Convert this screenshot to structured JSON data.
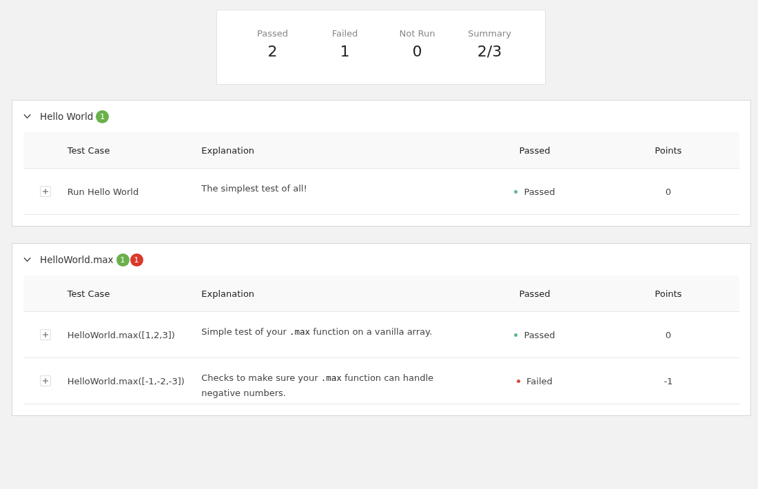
{
  "summary": [
    {
      "label": "Passed",
      "value": "2"
    },
    {
      "label": "Failed",
      "value": "1"
    },
    {
      "label": "Not Run",
      "value": "0"
    },
    {
      "label": "Summary",
      "value": "2/3"
    }
  ],
  "suites": [
    {
      "name": "Hello World",
      "expanded": true,
      "badges": [
        {
          "count": "1",
          "color": "#6ab04c"
        }
      ],
      "columns": [
        "Test Case",
        "Explanation",
        "Passed",
        "Points"
      ],
      "rows": [
        {
          "expanded": false,
          "test_case": "Run Hello World",
          "explanation": [
            {
              "text": "The simplest test of all!",
              "code": false
            }
          ],
          "status": "Passed",
          "color": "#5cb88a",
          "points": "0"
        }
      ]
    },
    {
      "name": "HelloWorld.max",
      "expanded": true,
      "badges": [
        {
          "count": "1",
          "color": "#6ab04c"
        },
        {
          "count": "1",
          "color": "#d9392b"
        }
      ],
      "columns": [
        "Test Case",
        "Explanation",
        "Passed",
        "Points"
      ],
      "rows": [
        {
          "expanded": false,
          "test_case": "HelloWorld.max([1,2,3])",
          "explanation": [
            {
              "text": "Simple test of your ",
              "code": false
            },
            {
              "text": ".max",
              "code": true
            },
            {
              "text": " function on a vanilla array.",
              "code": false
            }
          ],
          "status": "Passed",
          "color": "#5cb88a",
          "points": "0"
        },
        {
          "expanded": false,
          "test_case": "HelloWorld.max([-1,-2,-3])",
          "explanation": [
            {
              "text": "Checks to make sure your ",
              "code": false
            },
            {
              "text": ".max",
              "code": true
            },
            {
              "text": " function can handle negative numbers.",
              "code": false
            }
          ],
          "status": "Failed",
          "color": "#d9483b",
          "points": "-1"
        }
      ]
    }
  ]
}
